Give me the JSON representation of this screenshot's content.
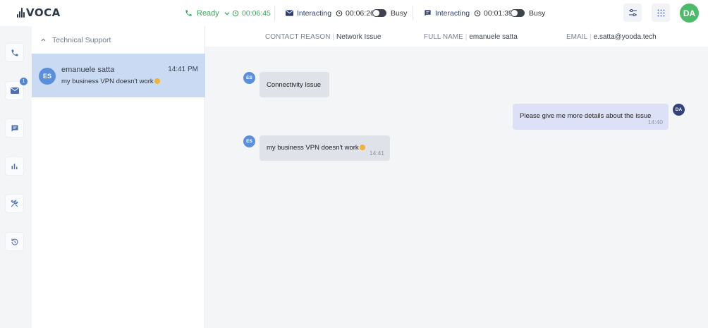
{
  "app": {
    "logo_text": "VOCA"
  },
  "topbar": {
    "status": "Ready",
    "status_timer": "00:06:45",
    "email_channel": {
      "label": "Interacting",
      "timer": "00:06:26",
      "toggle_label": "Busy"
    },
    "chat_channel": {
      "label": "Interacting",
      "timer": "00:01:39",
      "toggle_label": "Busy"
    },
    "user_initials": "DA"
  },
  "rail": {
    "email_badge": "1"
  },
  "conversations": {
    "group_title": "Technical Support",
    "items": [
      {
        "initials": "ES",
        "name": "emanuele satta",
        "time": "14:41 PM",
        "preview": "my business VPN doesn't work"
      }
    ]
  },
  "contact": {
    "reason_label": "CONTACT REASON",
    "reason_value": "Network Issue",
    "name_label": "FULL NAME",
    "name_value": "emanuele satta",
    "email_label": "EMAIL",
    "email_value": "e.satta@yooda.tech"
  },
  "messages": [
    {
      "from": "ES",
      "text": "Connectivity Issue",
      "time": ""
    },
    {
      "from": "DA",
      "text": "Please give me more details about the issue",
      "time": "14:40"
    },
    {
      "from": "ES",
      "text": "my business VPN doesn't work",
      "time": "14:41"
    }
  ],
  "colors": {
    "accent_green": "#3aa65a",
    "selected_row": "#c9daf2",
    "agent_bubble": "#dde1f7"
  }
}
